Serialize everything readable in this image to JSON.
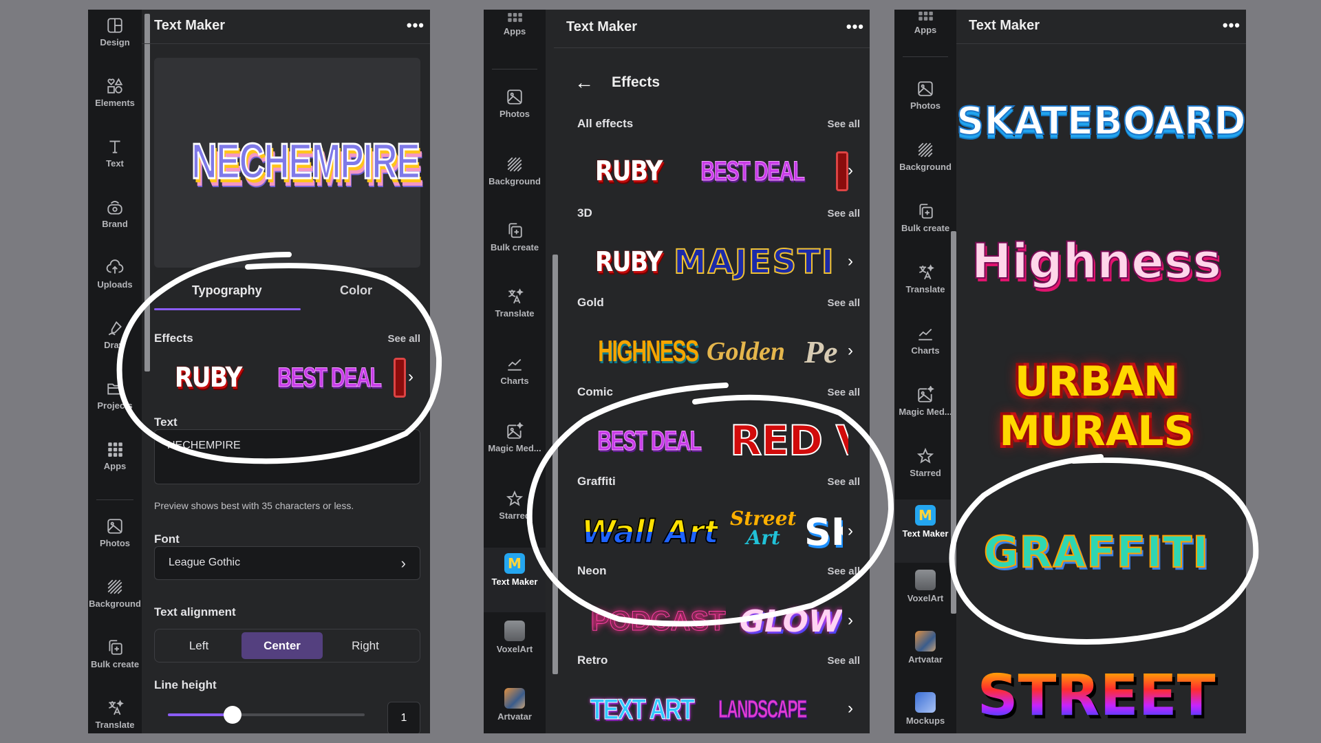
{
  "panels": [
    {
      "app_title": "Text Maker",
      "more_label": "•••",
      "rail": [
        {
          "label": "Design",
          "icon": "design-icon"
        },
        {
          "label": "Elements",
          "icon": "elements-icon"
        },
        {
          "label": "Text",
          "icon": "text-icon"
        },
        {
          "label": "Brand",
          "icon": "brand-icon"
        },
        {
          "label": "Uploads",
          "icon": "uploads-icon"
        },
        {
          "label": "Draw",
          "icon": "draw-icon"
        },
        {
          "label": "Projects",
          "icon": "projects-icon"
        },
        {
          "label": "Apps",
          "icon": "apps-icon"
        },
        {
          "label": "Photos",
          "icon": "photos-icon"
        },
        {
          "label": "Background",
          "icon": "background-icon"
        },
        {
          "label": "Bulk create",
          "icon": "bulk-create-icon"
        },
        {
          "label": "Translate",
          "icon": "translate-icon"
        }
      ],
      "preview_text": "NECHEMPIRE",
      "tabs": [
        {
          "label": "Typography",
          "active": true
        },
        {
          "label": "Color",
          "active": false
        }
      ],
      "effects_label": "Effects",
      "see_all": "See all",
      "effects": [
        "RUBY",
        "BEST DEAL"
      ],
      "text_label": "Text",
      "text_value": "NECHEMPIRE",
      "hint": "Preview shows best with 35 characters or less.",
      "font_label": "Font",
      "font_value": "League Gothic",
      "alignment_label": "Text alignment",
      "alignment_options": [
        "Left",
        "Center",
        "Right"
      ],
      "alignment_selected": "Center",
      "line_height_label": "Line height",
      "line_height_value": "1",
      "line_height_slider_fraction": 0.33
    },
    {
      "app_title": "Text Maker",
      "more_label": "•••",
      "rail": [
        {
          "label": "Apps",
          "icon": "apps-icon"
        },
        {
          "label": "Photos",
          "icon": "photos-icon"
        },
        {
          "label": "Background",
          "icon": "background-icon"
        },
        {
          "label": "Bulk create",
          "icon": "bulk-create-icon"
        },
        {
          "label": "Translate",
          "icon": "translate-icon"
        },
        {
          "label": "Charts",
          "icon": "charts-icon"
        },
        {
          "label": "Magic Med...",
          "icon": "magic-media-icon"
        },
        {
          "label": "Starred",
          "icon": "star-icon"
        },
        {
          "label": "Text Maker",
          "icon": "text-maker-app-icon",
          "active": true
        },
        {
          "label": "VoxelArt",
          "icon": "voxelart-app-icon"
        },
        {
          "label": "Artvatar",
          "icon": "artvatar-app-icon"
        }
      ],
      "back_label": "←",
      "page_title": "Effects",
      "see_all": "See all",
      "categories": [
        {
          "name": "All effects",
          "samples": [
            "RUBY",
            "BEST DEAL",
            "R"
          ]
        },
        {
          "name": "3D",
          "samples": [
            "RUBY",
            "MAJESTI"
          ]
        },
        {
          "name": "Gold",
          "samples": [
            "HIGHNESS",
            "Golden",
            "Pe"
          ]
        },
        {
          "name": "Comic",
          "samples": [
            "BEST DEAL",
            "RED V"
          ]
        },
        {
          "name": "Graffiti",
          "samples": [
            "Wall Art",
            "Street",
            "Art",
            "SK"
          ]
        },
        {
          "name": "Neon",
          "samples": [
            "PODCAST",
            "GLOW"
          ]
        },
        {
          "name": "Retro",
          "samples": [
            "TEXT ART",
            "LANDSCAPE"
          ]
        }
      ]
    },
    {
      "app_title": "Text Maker",
      "more_label": "•••",
      "rail": [
        {
          "label": "Apps",
          "icon": "apps-icon"
        },
        {
          "label": "Photos",
          "icon": "photos-icon"
        },
        {
          "label": "Background",
          "icon": "background-icon"
        },
        {
          "label": "Bulk create",
          "icon": "bulk-create-icon"
        },
        {
          "label": "Translate",
          "icon": "translate-icon"
        },
        {
          "label": "Charts",
          "icon": "charts-icon"
        },
        {
          "label": "Magic Med...",
          "icon": "magic-media-icon"
        },
        {
          "label": "Starred",
          "icon": "star-icon"
        },
        {
          "label": "Text Maker",
          "icon": "text-maker-app-icon",
          "active": true
        },
        {
          "label": "VoxelArt",
          "icon": "voxelart-app-icon"
        },
        {
          "label": "Artvatar",
          "icon": "artvatar-app-icon"
        },
        {
          "label": "Mockups",
          "icon": "mockups-app-icon"
        }
      ],
      "graffiti_samples": [
        "SKATEBOARD",
        "Highness",
        "URBAN",
        "MURALS",
        "GRAFFITI",
        "STREET"
      ]
    }
  ],
  "app_icon_letter": "M",
  "colors": {
    "accent": "#8b5cf6",
    "selected_segment": "#54407f",
    "panel_bg": "#252628",
    "rail_bg": "#18191b",
    "page_bg": "#7b7b80"
  }
}
